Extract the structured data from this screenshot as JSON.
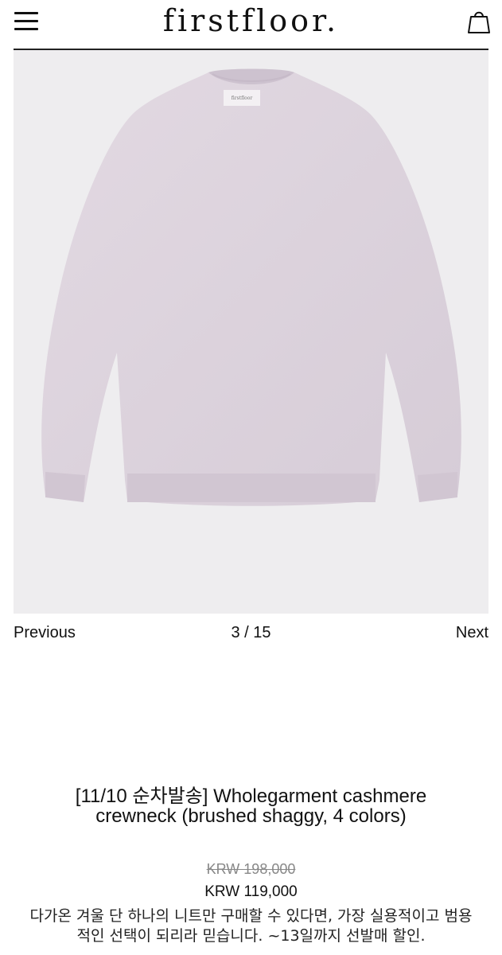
{
  "header": {
    "logo": "firstfloor.",
    "menu_icon": "hamburger-menu-icon",
    "cart_icon": "shopping-bag-icon"
  },
  "gallery": {
    "label_text": "firstfloor",
    "background": "#eeedef",
    "sweater_color": "#ddd3dd"
  },
  "pager": {
    "previous": "Previous",
    "count": "3 / 15",
    "next": "Next"
  },
  "product": {
    "title_line1": "[11/10 순차발송] Wholegarment cashmere",
    "title_line2": "crewneck (brushed shaggy, 4 colors)",
    "price_original": "KRW 198,000",
    "price_sale": "KRW 119,000",
    "desc_line1": "다가온 겨울 단 하나의 니트만 구매할 수 있다면, 가장 실용적이고 범용",
    "desc_line2": "적인 선택이 되리라 믿습니다. ~13일까지 선발매 할인."
  }
}
